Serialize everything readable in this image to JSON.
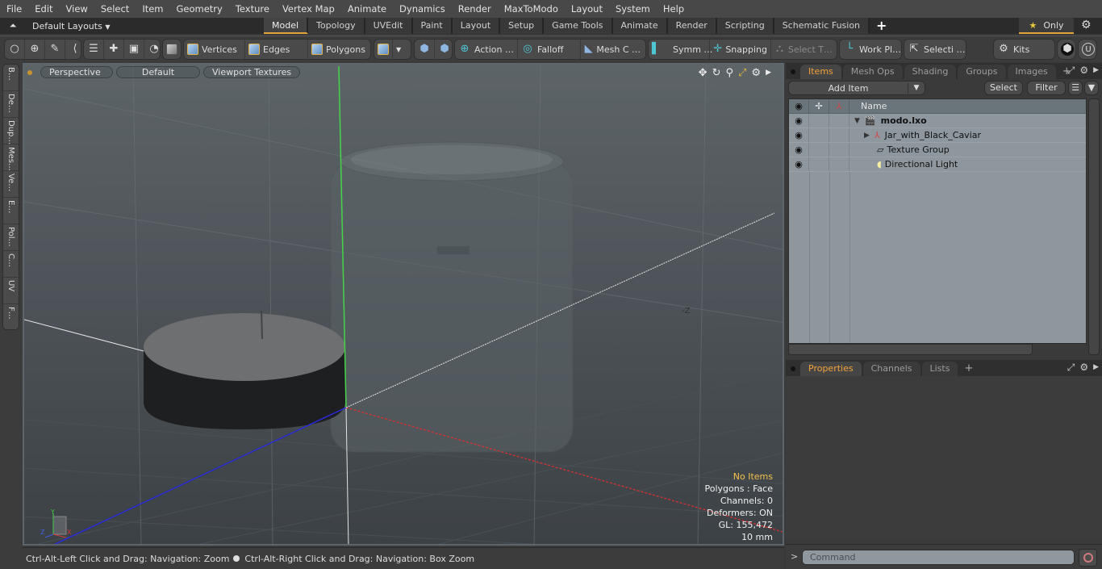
{
  "menu": [
    "File",
    "Edit",
    "View",
    "Select",
    "Item",
    "Geometry",
    "Texture",
    "Vertex Map",
    "Animate",
    "Dynamics",
    "Render",
    "MaxToModo",
    "Layout",
    "System",
    "Help"
  ],
  "layouts": {
    "label": "Default Layouts"
  },
  "layout_tabs": [
    {
      "label": "Model",
      "active": true
    },
    {
      "label": "Topology"
    },
    {
      "label": "UVEdit"
    },
    {
      "label": "Paint"
    },
    {
      "label": "Layout"
    },
    {
      "label": "Setup"
    },
    {
      "label": "Game Tools"
    },
    {
      "label": "Animate"
    },
    {
      "label": "Render"
    },
    {
      "label": "Scripting"
    },
    {
      "label": "Schematic Fusion"
    }
  ],
  "only_label": "Only",
  "toolbar": {
    "vertices": "Vertices",
    "edges": "Edges",
    "polygons": "Polygons",
    "action": "Action …",
    "falloff": "Falloff",
    "meshc": "Mesh C …",
    "symm": "Symm …",
    "snapping": "Snapping",
    "selectt": "Select T…",
    "workpl": "Work Pl…",
    "selecti": "Selecti …",
    "kits": "Kits"
  },
  "left_tabs": [
    "B…",
    "De…",
    "Dup…",
    "Mes…",
    "Ve…",
    "E…",
    "Pol…",
    "C…",
    "UV",
    "F…"
  ],
  "viewport": {
    "view": "Perspective",
    "shading": "Default",
    "textures": "Viewport Textures",
    "axis_label": "-Z",
    "info": {
      "selection": "No Items",
      "polygons": "Polygons : Face",
      "channels": "Channels: 0",
      "deformers": "Deformers: ON",
      "gl": "GL: 155,472",
      "grid": "10 mm"
    }
  },
  "status": {
    "hint1": "Ctrl-Alt-Left Click and Drag: Navigation: Zoom",
    "hint2": "Ctrl-Alt-Right Click and Drag: Navigation: Box Zoom"
  },
  "items_panel": {
    "tabs": [
      {
        "label": "Items",
        "active": true
      },
      {
        "label": "Mesh Ops"
      },
      {
        "label": "Shading"
      },
      {
        "label": "Groups"
      },
      {
        "label": "Images"
      }
    ],
    "add_item": "Add Item",
    "select": "Select",
    "filter": "Filter",
    "column_name": "Name",
    "rows": [
      {
        "name": "modo.lxo",
        "icon": "scene-icon",
        "bold": true
      },
      {
        "name": "Jar_with_Black_Caviar",
        "icon": "mesh-locator-icon"
      },
      {
        "name": "Texture Group",
        "icon": "texture-group-icon"
      },
      {
        "name": "Directional Light",
        "icon": "light-icon"
      }
    ]
  },
  "props_panel": {
    "tabs": [
      {
        "label": "Properties",
        "active": true
      },
      {
        "label": "Channels"
      },
      {
        "label": "Lists"
      }
    ]
  },
  "command": {
    "placeholder": "Command",
    "prompt": ">"
  }
}
